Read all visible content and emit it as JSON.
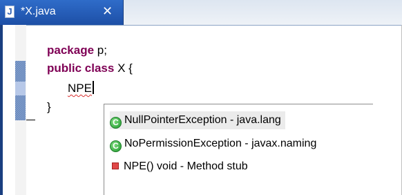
{
  "tab": {
    "icon": "java-file-icon",
    "icon_glyph": "J",
    "title": "*X.java",
    "close_glyph": "✕"
  },
  "editor": {
    "lines": [
      {
        "keyword": "package",
        "rest": " p;"
      },
      {
        "keyword": "public",
        "keyword2": "class",
        "rest": " X {"
      },
      {
        "typed": "NPE"
      },
      {
        "rest": "}"
      }
    ]
  },
  "assist": {
    "items": [
      {
        "icon": "class-icon",
        "glyph": "C",
        "label": "NullPointerException - java.lang",
        "selected": true
      },
      {
        "icon": "class-icon",
        "glyph": "C",
        "label": "NoPermissionException - javax.naming",
        "selected": false
      },
      {
        "icon": "method-icon",
        "label": "NPE()  void - Method stub",
        "selected": false
      }
    ]
  },
  "colors": {
    "keyword": "#7f0055",
    "tab_active": "#2f6cc9",
    "selection": "#ebebeb"
  }
}
